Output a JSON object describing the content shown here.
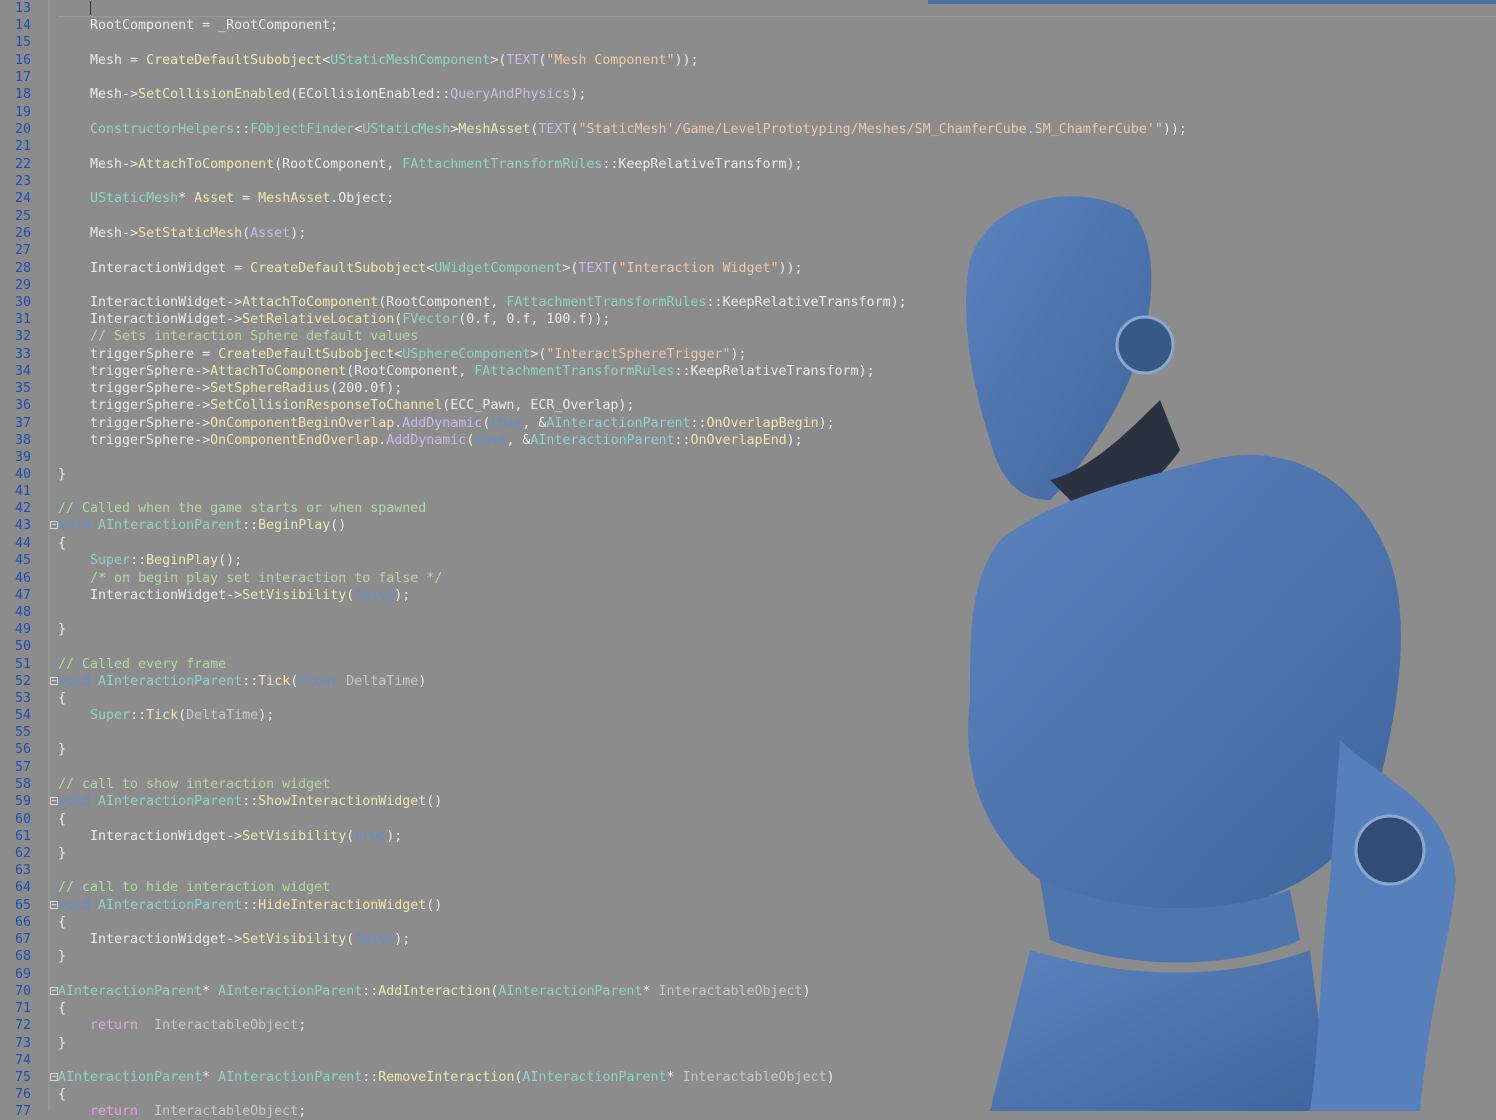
{
  "editor": {
    "lines": [
      {
        "n": "13",
        "fold": false,
        "tokens": [
          {
            "t": "    "
          },
          {
            "t": "|",
            "c": "caret"
          }
        ]
      },
      {
        "n": "14",
        "fold": false,
        "tokens": [
          {
            "t": "    RootComponent = _RootComponent;"
          }
        ]
      },
      {
        "n": "15",
        "fold": false,
        "tokens": []
      },
      {
        "n": "16",
        "fold": false,
        "tokens": [
          {
            "t": "    Mesh = "
          },
          {
            "t": "CreateDefaultSubobject",
            "c": "fn"
          },
          {
            "t": "<"
          },
          {
            "t": "UStaticMeshComponent",
            "c": "type"
          },
          {
            "t": ">("
          },
          {
            "t": "TEXT",
            "c": "enum"
          },
          {
            "t": "("
          },
          {
            "t": "\"Mesh Component\"",
            "c": "str"
          },
          {
            "t": "));"
          }
        ]
      },
      {
        "n": "17",
        "fold": false,
        "tokens": []
      },
      {
        "n": "18",
        "fold": false,
        "tokens": [
          {
            "t": "    Mesh->"
          },
          {
            "t": "SetCollisionEnabled",
            "c": "fn"
          },
          {
            "t": "(ECollisionEnabled::"
          },
          {
            "t": "QueryAndPhysics",
            "c": "enum"
          },
          {
            "t": ");"
          }
        ]
      },
      {
        "n": "19",
        "fold": false,
        "tokens": []
      },
      {
        "n": "20",
        "fold": false,
        "tokens": [
          {
            "t": "    "
          },
          {
            "t": "ConstructorHelpers",
            "c": "type"
          },
          {
            "t": "::"
          },
          {
            "t": "FObjectFinder",
            "c": "type"
          },
          {
            "t": "<"
          },
          {
            "t": "UStaticMesh",
            "c": "type"
          },
          {
            "t": ">"
          },
          {
            "t": "MeshAsset",
            "c": "fn"
          },
          {
            "t": "("
          },
          {
            "t": "TEXT",
            "c": "enum"
          },
          {
            "t": "("
          },
          {
            "t": "\"StaticMesh'/Game/LevelPrototyping/Meshes/SM_ChamferCube.SM_ChamferCube'\"",
            "c": "str"
          },
          {
            "t": "));"
          }
        ]
      },
      {
        "n": "21",
        "fold": false,
        "tokens": []
      },
      {
        "n": "22",
        "fold": false,
        "tokens": [
          {
            "t": "    Mesh->"
          },
          {
            "t": "AttachToComponent",
            "c": "fn"
          },
          {
            "t": "(RootComponent, "
          },
          {
            "t": "FAttachmentTransformRules",
            "c": "type"
          },
          {
            "t": "::KeepRelativeTransform);"
          }
        ]
      },
      {
        "n": "23",
        "fold": false,
        "tokens": []
      },
      {
        "n": "24",
        "fold": false,
        "tokens": [
          {
            "t": "    "
          },
          {
            "t": "UStaticMesh",
            "c": "type"
          },
          {
            "t": "* "
          },
          {
            "t": "Asset",
            "c": "fn"
          },
          {
            "t": " = "
          },
          {
            "t": "MeshAsset",
            "c": "fn"
          },
          {
            "t": ".Object;"
          }
        ]
      },
      {
        "n": "25",
        "fold": false,
        "tokens": []
      },
      {
        "n": "26",
        "fold": false,
        "tokens": [
          {
            "t": "    Mesh->"
          },
          {
            "t": "SetStaticMesh",
            "c": "fn"
          },
          {
            "t": "("
          },
          {
            "t": "Asset",
            "c": "enum"
          },
          {
            "t": ");"
          }
        ]
      },
      {
        "n": "27",
        "fold": false,
        "tokens": []
      },
      {
        "n": "28",
        "fold": false,
        "tokens": [
          {
            "t": "    InteractionWidget = "
          },
          {
            "t": "CreateDefaultSubobject",
            "c": "fn"
          },
          {
            "t": "<"
          },
          {
            "t": "UWidgetComponent",
            "c": "type"
          },
          {
            "t": ">("
          },
          {
            "t": "TEXT",
            "c": "enum"
          },
          {
            "t": "("
          },
          {
            "t": "\"Interaction Widget\"",
            "c": "str"
          },
          {
            "t": "));"
          }
        ]
      },
      {
        "n": "29",
        "fold": false,
        "tokens": []
      },
      {
        "n": "30",
        "fold": false,
        "tokens": [
          {
            "t": "    InteractionWidget->"
          },
          {
            "t": "AttachToComponent",
            "c": "fn"
          },
          {
            "t": "(RootComponent, "
          },
          {
            "t": "FAttachmentTransformRules",
            "c": "type"
          },
          {
            "t": "::KeepRelativeTransform);"
          }
        ]
      },
      {
        "n": "31",
        "fold": false,
        "tokens": [
          {
            "t": "    InteractionWidget->"
          },
          {
            "t": "SetRelativeLocation",
            "c": "fn"
          },
          {
            "t": "("
          },
          {
            "t": "FVector",
            "c": "type"
          },
          {
            "t": "(0.f, 0.f, 100.f));"
          }
        ]
      },
      {
        "n": "32",
        "fold": false,
        "tokens": [
          {
            "t": "    "
          },
          {
            "t": "// Sets interaction Sphere default values",
            "c": "com"
          }
        ]
      },
      {
        "n": "33",
        "fold": false,
        "tokens": [
          {
            "t": "    triggerSphere = "
          },
          {
            "t": "CreateDefaultSubobject",
            "c": "fn"
          },
          {
            "t": "<"
          },
          {
            "t": "USphereComponent",
            "c": "type"
          },
          {
            "t": ">("
          },
          {
            "t": "\"InteractSphereTrigger\"",
            "c": "str"
          },
          {
            "t": ");"
          }
        ]
      },
      {
        "n": "34",
        "fold": false,
        "tokens": [
          {
            "t": "    triggerSphere->"
          },
          {
            "t": "AttachToComponent",
            "c": "fn"
          },
          {
            "t": "(RootComponent, "
          },
          {
            "t": "FAttachmentTransformRules",
            "c": "type"
          },
          {
            "t": "::KeepRelativeTransform);"
          }
        ]
      },
      {
        "n": "35",
        "fold": false,
        "tokens": [
          {
            "t": "    triggerSphere->"
          },
          {
            "t": "SetSphereRadius",
            "c": "fn"
          },
          {
            "t": "(200.0f);"
          }
        ]
      },
      {
        "n": "36",
        "fold": false,
        "tokens": [
          {
            "t": "    triggerSphere->"
          },
          {
            "t": "SetCollisionResponseToChannel",
            "c": "fn"
          },
          {
            "t": "(ECC_Pawn, ECR_Overlap);"
          }
        ]
      },
      {
        "n": "37",
        "fold": false,
        "tokens": [
          {
            "t": "    triggerSphere->"
          },
          {
            "t": "OnComponentBeginOverlap",
            "c": "fn"
          },
          {
            "t": "."
          },
          {
            "t": "AddDynamic",
            "c": "enum"
          },
          {
            "t": "("
          },
          {
            "t": "this",
            "c": "kw"
          },
          {
            "t": ", &"
          },
          {
            "t": "AInteractionParent",
            "c": "type"
          },
          {
            "t": "::"
          },
          {
            "t": "OnOverlapBegin",
            "c": "fn"
          },
          {
            "t": ");"
          }
        ]
      },
      {
        "n": "38",
        "fold": false,
        "tokens": [
          {
            "t": "    triggerSphere->"
          },
          {
            "t": "OnComponentEndOverlap",
            "c": "fn"
          },
          {
            "t": "."
          },
          {
            "t": "AddDynamic",
            "c": "enum"
          },
          {
            "t": "("
          },
          {
            "t": "this",
            "c": "kw"
          },
          {
            "t": ", &"
          },
          {
            "t": "AInteractionParent",
            "c": "type"
          },
          {
            "t": "::"
          },
          {
            "t": "OnOverlapEnd",
            "c": "fn"
          },
          {
            "t": ");"
          }
        ]
      },
      {
        "n": "39",
        "fold": false,
        "tokens": []
      },
      {
        "n": "40",
        "fold": false,
        "tokens": [
          {
            "t": "}"
          }
        ]
      },
      {
        "n": "41",
        "fold": false,
        "tokens": []
      },
      {
        "n": "42",
        "fold": false,
        "tokens": [
          {
            "t": "// Called when the game starts or when spawned",
            "c": "com"
          }
        ]
      },
      {
        "n": "43",
        "fold": true,
        "tokens": [
          {
            "t": "void",
            "c": "kw"
          },
          {
            "t": " "
          },
          {
            "t": "AInteractionParent",
            "c": "type"
          },
          {
            "t": "::"
          },
          {
            "t": "BeginPlay",
            "c": "fn"
          },
          {
            "t": "()"
          }
        ]
      },
      {
        "n": "44",
        "fold": false,
        "tokens": [
          {
            "t": "{"
          }
        ]
      },
      {
        "n": "45",
        "fold": false,
        "tokens": [
          {
            "t": "    "
          },
          {
            "t": "Super",
            "c": "type"
          },
          {
            "t": "::"
          },
          {
            "t": "BeginPlay",
            "c": "fn"
          },
          {
            "t": "();"
          }
        ]
      },
      {
        "n": "46",
        "fold": false,
        "tokens": [
          {
            "t": "    "
          },
          {
            "t": "/* on begin play set interaction to false */",
            "c": "com"
          }
        ]
      },
      {
        "n": "47",
        "fold": false,
        "tokens": [
          {
            "t": "    InteractionWidget->"
          },
          {
            "t": "SetVisibility",
            "c": "fn"
          },
          {
            "t": "("
          },
          {
            "t": "false",
            "c": "kw"
          },
          {
            "t": ");"
          }
        ]
      },
      {
        "n": "48",
        "fold": false,
        "tokens": []
      },
      {
        "n": "49",
        "fold": false,
        "tokens": [
          {
            "t": "}"
          }
        ]
      },
      {
        "n": "50",
        "fold": false,
        "tokens": []
      },
      {
        "n": "51",
        "fold": false,
        "tokens": [
          {
            "t": "// Called every frame",
            "c": "com"
          }
        ]
      },
      {
        "n": "52",
        "fold": true,
        "tokens": [
          {
            "t": "void",
            "c": "kw"
          },
          {
            "t": " "
          },
          {
            "t": "AInteractionParent",
            "c": "type"
          },
          {
            "t": "::"
          },
          {
            "t": "Tick",
            "c": "fn"
          },
          {
            "t": "("
          },
          {
            "t": "float",
            "c": "kw"
          },
          {
            "t": " "
          },
          {
            "t": "DeltaTime",
            "c": "prm"
          },
          {
            "t": ")"
          }
        ]
      },
      {
        "n": "53",
        "fold": false,
        "tokens": [
          {
            "t": "{"
          }
        ]
      },
      {
        "n": "54",
        "fold": false,
        "tokens": [
          {
            "t": "    "
          },
          {
            "t": "Super",
            "c": "type"
          },
          {
            "t": "::"
          },
          {
            "t": "Tick",
            "c": "fn"
          },
          {
            "t": "("
          },
          {
            "t": "DeltaTime",
            "c": "prm"
          },
          {
            "t": ");"
          }
        ]
      },
      {
        "n": "55",
        "fold": false,
        "tokens": []
      },
      {
        "n": "56",
        "fold": false,
        "tokens": [
          {
            "t": "}"
          }
        ]
      },
      {
        "n": "57",
        "fold": false,
        "tokens": []
      },
      {
        "n": "58",
        "fold": false,
        "tokens": [
          {
            "t": "// call to show interaction widget",
            "c": "com"
          }
        ]
      },
      {
        "n": "59",
        "fold": true,
        "tokens": [
          {
            "t": "void",
            "c": "kw"
          },
          {
            "t": " "
          },
          {
            "t": "AInteractionParent",
            "c": "type"
          },
          {
            "t": "::"
          },
          {
            "t": "ShowInteractionWidget",
            "c": "fn"
          },
          {
            "t": "()"
          }
        ]
      },
      {
        "n": "60",
        "fold": false,
        "tokens": [
          {
            "t": "{"
          }
        ]
      },
      {
        "n": "61",
        "fold": false,
        "tokens": [
          {
            "t": "    InteractionWidget->"
          },
          {
            "t": "SetVisibility",
            "c": "fn"
          },
          {
            "t": "("
          },
          {
            "t": "true",
            "c": "kw"
          },
          {
            "t": ");"
          }
        ]
      },
      {
        "n": "62",
        "fold": false,
        "tokens": [
          {
            "t": "}"
          }
        ]
      },
      {
        "n": "63",
        "fold": false,
        "tokens": []
      },
      {
        "n": "64",
        "fold": false,
        "tokens": [
          {
            "t": "// call to hide interaction widget",
            "c": "com"
          }
        ]
      },
      {
        "n": "65",
        "fold": true,
        "tokens": [
          {
            "t": "void",
            "c": "kw"
          },
          {
            "t": " "
          },
          {
            "t": "AInteractionParent",
            "c": "type"
          },
          {
            "t": "::"
          },
          {
            "t": "HideInteractionWidget",
            "c": "fn"
          },
          {
            "t": "()"
          }
        ]
      },
      {
        "n": "66",
        "fold": false,
        "tokens": [
          {
            "t": "{"
          }
        ]
      },
      {
        "n": "67",
        "fold": false,
        "tokens": [
          {
            "t": "    InteractionWidget->"
          },
          {
            "t": "SetVisibility",
            "c": "fn"
          },
          {
            "t": "("
          },
          {
            "t": "false",
            "c": "kw"
          },
          {
            "t": ");"
          }
        ]
      },
      {
        "n": "68",
        "fold": false,
        "tokens": [
          {
            "t": "}"
          }
        ]
      },
      {
        "n": "69",
        "fold": false,
        "tokens": []
      },
      {
        "n": "70",
        "fold": true,
        "tokens": [
          {
            "t": "AInteractionParent",
            "c": "type"
          },
          {
            "t": "* "
          },
          {
            "t": "AInteractionParent",
            "c": "type"
          },
          {
            "t": "::"
          },
          {
            "t": "AddInteraction",
            "c": "fn"
          },
          {
            "t": "("
          },
          {
            "t": "AInteractionParent",
            "c": "type"
          },
          {
            "t": "* "
          },
          {
            "t": "InteractableObject",
            "c": "prm"
          },
          {
            "t": ")"
          }
        ]
      },
      {
        "n": "71",
        "fold": false,
        "tokens": [
          {
            "t": "{"
          }
        ]
      },
      {
        "n": "72",
        "fold": false,
        "tokens": [
          {
            "t": "    "
          },
          {
            "t": "return",
            "c": "ret"
          },
          {
            "t": "  "
          },
          {
            "t": "InteractableObject",
            "c": "prm"
          },
          {
            "t": ";"
          }
        ]
      },
      {
        "n": "73",
        "fold": false,
        "tokens": [
          {
            "t": "}"
          }
        ]
      },
      {
        "n": "74",
        "fold": false,
        "tokens": []
      },
      {
        "n": "75",
        "fold": true,
        "tokens": [
          {
            "t": "AInteractionParent",
            "c": "type"
          },
          {
            "t": "* "
          },
          {
            "t": "AInteractionParent",
            "c": "type"
          },
          {
            "t": "::"
          },
          {
            "t": "RemoveInteraction",
            "c": "fn"
          },
          {
            "t": "("
          },
          {
            "t": "AInteractionParent",
            "c": "type"
          },
          {
            "t": "* "
          },
          {
            "t": "InteractableObject",
            "c": "prm"
          },
          {
            "t": ")"
          }
        ]
      },
      {
        "n": "76",
        "fold": false,
        "tokens": [
          {
            "t": "{"
          }
        ]
      },
      {
        "n": "77",
        "fold": false,
        "tokens": [
          {
            "t": "    "
          },
          {
            "t": "return",
            "c": "ret"
          },
          {
            "t": "  "
          },
          {
            "t": "InteractableObject",
            "c": "prm"
          },
          {
            "t": ";"
          }
        ]
      }
    ]
  },
  "overlay": {
    "character_color": "#4a6fa5"
  }
}
